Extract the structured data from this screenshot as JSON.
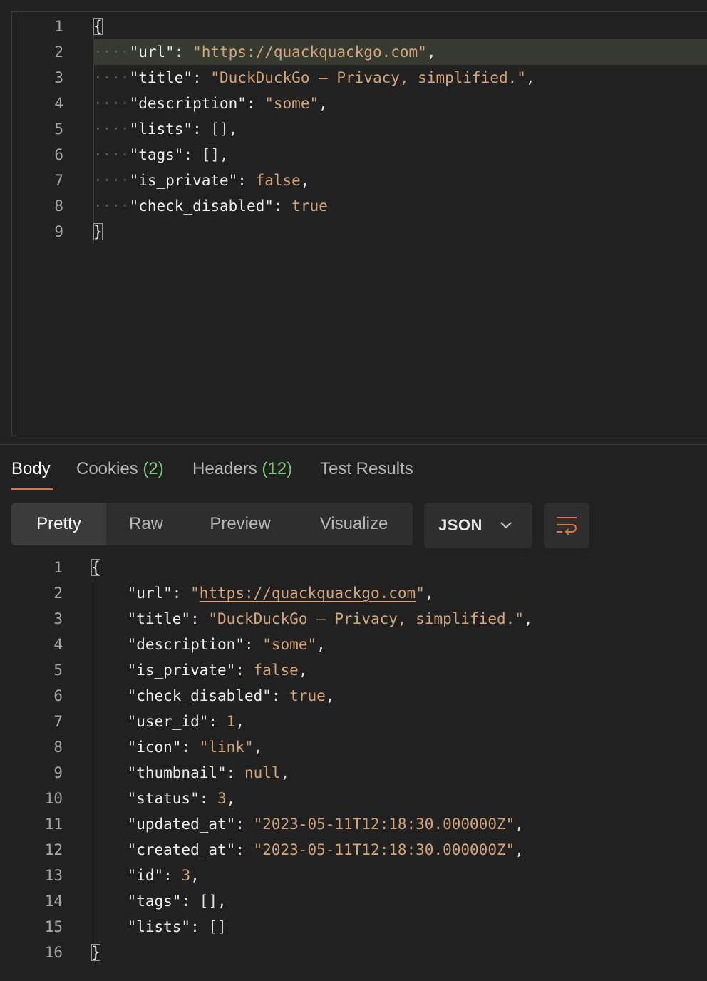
{
  "request_body": {
    "lines": [
      {
        "n": "1",
        "indent": 0,
        "tokens": [
          {
            "t": "{",
            "c": "brace"
          }
        ]
      },
      {
        "n": "2",
        "indent": 1,
        "highlight": true,
        "tokens": [
          {
            "t": "\"url\"",
            "c": "k"
          },
          {
            "t": ": ",
            "c": "p"
          },
          {
            "t": "\"https://quackquackgo.com\"",
            "c": "s"
          },
          {
            "t": ",",
            "c": "p"
          }
        ]
      },
      {
        "n": "3",
        "indent": 1,
        "tokens": [
          {
            "t": "\"title\"",
            "c": "k"
          },
          {
            "t": ": ",
            "c": "p"
          },
          {
            "t": "\"DuckDuckGo — Privacy, simplified.\"",
            "c": "s"
          },
          {
            "t": ",",
            "c": "p"
          }
        ]
      },
      {
        "n": "4",
        "indent": 1,
        "tokens": [
          {
            "t": "\"description\"",
            "c": "k"
          },
          {
            "t": ": ",
            "c": "p"
          },
          {
            "t": "\"some\"",
            "c": "s"
          },
          {
            "t": ",",
            "c": "p"
          }
        ]
      },
      {
        "n": "5",
        "indent": 1,
        "tokens": [
          {
            "t": "\"lists\"",
            "c": "k"
          },
          {
            "t": ": ",
            "c": "p"
          },
          {
            "t": "[]",
            "c": "p"
          },
          {
            "t": ",",
            "c": "p"
          }
        ]
      },
      {
        "n": "6",
        "indent": 1,
        "tokens": [
          {
            "t": "\"tags\"",
            "c": "k"
          },
          {
            "t": ": ",
            "c": "p"
          },
          {
            "t": "[]",
            "c": "p"
          },
          {
            "t": ",",
            "c": "p"
          }
        ]
      },
      {
        "n": "7",
        "indent": 1,
        "tokens": [
          {
            "t": "\"is_private\"",
            "c": "k"
          },
          {
            "t": ": ",
            "c": "p"
          },
          {
            "t": "false",
            "c": "b"
          },
          {
            "t": ",",
            "c": "p"
          }
        ]
      },
      {
        "n": "8",
        "indent": 1,
        "tokens": [
          {
            "t": "\"check_disabled\"",
            "c": "k"
          },
          {
            "t": ": ",
            "c": "p"
          },
          {
            "t": "true",
            "c": "b"
          }
        ]
      },
      {
        "n": "9",
        "indent": 0,
        "tokens": [
          {
            "t": "}",
            "c": "brace"
          }
        ]
      }
    ]
  },
  "response_tabs": [
    {
      "label": "Body",
      "count": "",
      "active": true
    },
    {
      "label": "Cookies",
      "count": "(2)",
      "active": false
    },
    {
      "label": "Headers",
      "count": "(12)",
      "active": false
    },
    {
      "label": "Test Results",
      "count": "",
      "active": false
    }
  ],
  "view_modes": [
    {
      "label": "Pretty",
      "active": true
    },
    {
      "label": "Raw",
      "active": false
    },
    {
      "label": "Preview",
      "active": false
    },
    {
      "label": "Visualize",
      "active": false
    }
  ],
  "format": {
    "selected": "JSON",
    "icon": "chevron-down-icon"
  },
  "wrap_button": {
    "icon": "text-wrap-icon"
  },
  "colors": {
    "accent": "#e8722f",
    "count": "#7cc47a",
    "string": "#d2a57c",
    "background": "#212121"
  },
  "response_body": {
    "lines": [
      {
        "n": "1",
        "indent": 0,
        "tokens": [
          {
            "t": "{",
            "c": "brace"
          }
        ]
      },
      {
        "n": "2",
        "indent": 1,
        "tokens": [
          {
            "t": "\"url\"",
            "c": "k"
          },
          {
            "t": ": ",
            "c": "p"
          },
          {
            "t": "\"",
            "c": "s"
          },
          {
            "t": "https://quackquackgo.com",
            "c": "s ul"
          },
          {
            "t": "\"",
            "c": "s"
          },
          {
            "t": ",",
            "c": "p"
          }
        ]
      },
      {
        "n": "3",
        "indent": 1,
        "tokens": [
          {
            "t": "\"title\"",
            "c": "k"
          },
          {
            "t": ": ",
            "c": "p"
          },
          {
            "t": "\"DuckDuckGo — Privacy, simplified.\"",
            "c": "s"
          },
          {
            "t": ",",
            "c": "p"
          }
        ]
      },
      {
        "n": "4",
        "indent": 1,
        "tokens": [
          {
            "t": "\"description\"",
            "c": "k"
          },
          {
            "t": ": ",
            "c": "p"
          },
          {
            "t": "\"some\"",
            "c": "s"
          },
          {
            "t": ",",
            "c": "p"
          }
        ]
      },
      {
        "n": "5",
        "indent": 1,
        "tokens": [
          {
            "t": "\"is_private\"",
            "c": "k"
          },
          {
            "t": ": ",
            "c": "p"
          },
          {
            "t": "false",
            "c": "b"
          },
          {
            "t": ",",
            "c": "p"
          }
        ]
      },
      {
        "n": "6",
        "indent": 1,
        "tokens": [
          {
            "t": "\"check_disabled\"",
            "c": "k"
          },
          {
            "t": ": ",
            "c": "p"
          },
          {
            "t": "true",
            "c": "b"
          },
          {
            "t": ",",
            "c": "p"
          }
        ]
      },
      {
        "n": "7",
        "indent": 1,
        "tokens": [
          {
            "t": "\"user_id\"",
            "c": "k"
          },
          {
            "t": ": ",
            "c": "p"
          },
          {
            "t": "1",
            "c": "b"
          },
          {
            "t": ",",
            "c": "p"
          }
        ]
      },
      {
        "n": "8",
        "indent": 1,
        "tokens": [
          {
            "t": "\"icon\"",
            "c": "k"
          },
          {
            "t": ": ",
            "c": "p"
          },
          {
            "t": "\"link\"",
            "c": "s"
          },
          {
            "t": ",",
            "c": "p"
          }
        ]
      },
      {
        "n": "9",
        "indent": 1,
        "tokens": [
          {
            "t": "\"thumbnail\"",
            "c": "k"
          },
          {
            "t": ": ",
            "c": "p"
          },
          {
            "t": "null",
            "c": "b"
          },
          {
            "t": ",",
            "c": "p"
          }
        ]
      },
      {
        "n": "10",
        "indent": 1,
        "tokens": [
          {
            "t": "\"status\"",
            "c": "k"
          },
          {
            "t": ": ",
            "c": "p"
          },
          {
            "t": "3",
            "c": "b"
          },
          {
            "t": ",",
            "c": "p"
          }
        ]
      },
      {
        "n": "11",
        "indent": 1,
        "tokens": [
          {
            "t": "\"updated_at\"",
            "c": "k"
          },
          {
            "t": ": ",
            "c": "p"
          },
          {
            "t": "\"2023-05-11T12:18:30.000000Z\"",
            "c": "s"
          },
          {
            "t": ",",
            "c": "p"
          }
        ]
      },
      {
        "n": "12",
        "indent": 1,
        "tokens": [
          {
            "t": "\"created_at\"",
            "c": "k"
          },
          {
            "t": ": ",
            "c": "p"
          },
          {
            "t": "\"2023-05-11T12:18:30.000000Z\"",
            "c": "s"
          },
          {
            "t": ",",
            "c": "p"
          }
        ]
      },
      {
        "n": "13",
        "indent": 1,
        "tokens": [
          {
            "t": "\"id\"",
            "c": "k"
          },
          {
            "t": ": ",
            "c": "p"
          },
          {
            "t": "3",
            "c": "b"
          },
          {
            "t": ",",
            "c": "p"
          }
        ]
      },
      {
        "n": "14",
        "indent": 1,
        "tokens": [
          {
            "t": "\"tags\"",
            "c": "k"
          },
          {
            "t": ": ",
            "c": "p"
          },
          {
            "t": "[]",
            "c": "p"
          },
          {
            "t": ",",
            "c": "p"
          }
        ]
      },
      {
        "n": "15",
        "indent": 1,
        "tokens": [
          {
            "t": "\"lists\"",
            "c": "k"
          },
          {
            "t": ": ",
            "c": "p"
          },
          {
            "t": "[]",
            "c": "p"
          }
        ]
      },
      {
        "n": "16",
        "indent": 0,
        "tokens": [
          {
            "t": "}",
            "c": "brace"
          }
        ]
      }
    ]
  }
}
